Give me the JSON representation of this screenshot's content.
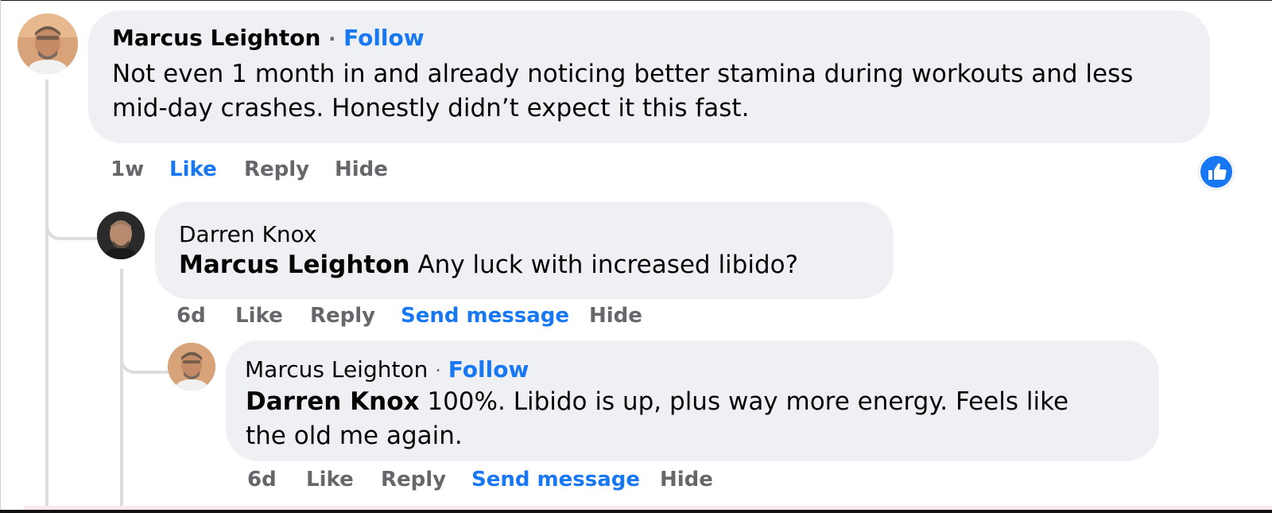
{
  "comments": [
    {
      "author": "Marcus Leighton",
      "separator": "·",
      "follow_label": "Follow",
      "tagged": "",
      "text_lines": [
        "Not even 1 month in and already noticing better stamina during workouts and less",
        "mid-day crashes. Honestly didn’t expect it this fast."
      ],
      "actions": {
        "time": "1w",
        "like": "Like",
        "reply": "Reply",
        "hide": "Hide"
      },
      "like_active": true,
      "reaction_icon": "thumbs-up-icon"
    },
    {
      "author": "Darren Knox",
      "tagged": "Marcus Leighton",
      "text": "Any luck with increased libido?",
      "actions": {
        "time": "6d",
        "like": "Like",
        "reply": "Reply",
        "send_message": "Send message",
        "hide": "Hide"
      }
    },
    {
      "author": "Marcus Leighton",
      "separator": "·",
      "follow_label": "Follow",
      "tagged": "Darren Knox",
      "text_lines": [
        "100%. Libido is up, plus way more energy. Feels like",
        "the old me again."
      ],
      "actions": {
        "time": "6d",
        "like": "Like",
        "reply": "Reply",
        "send_message": "Send message",
        "hide": "Hide"
      }
    }
  ],
  "colors": {
    "accent": "#1877f2",
    "bubble": "#eef0f3",
    "muted": "#65676b",
    "thread_line": "#dcdde1"
  }
}
